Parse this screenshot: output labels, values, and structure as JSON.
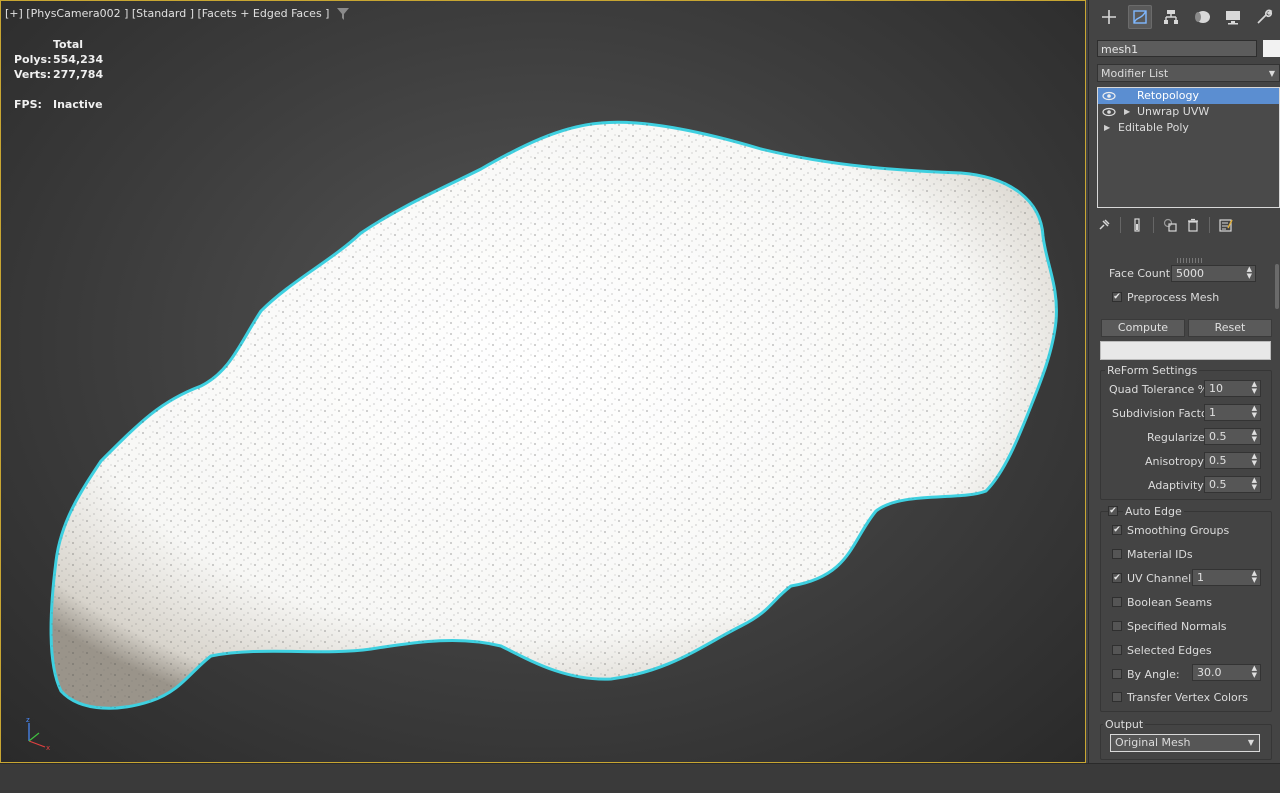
{
  "viewport": {
    "label": "[+] [PhysCamera002 ] [Standard ] [Facets + Edged Faces ]",
    "stats": {
      "header": "Total",
      "polys_label": "Polys:",
      "polys": "554,234",
      "verts_label": "Verts:",
      "verts": "277,784",
      "fps_label": "FPS:",
      "fps": "Inactive"
    },
    "selection_outline_color": "#3ed0e0",
    "border_color": "#c8a632"
  },
  "command_panel": {
    "tabs": [
      "create-icon",
      "modify-icon",
      "hierarchy-icon",
      "motion-icon",
      "display-icon",
      "utilities-icon"
    ],
    "active_tab": "modify-icon",
    "object_name": "mesh1",
    "object_color": "#f2f2f2",
    "modifier_list": "Modifier List",
    "stack": [
      {
        "name": "Retopology",
        "selected": true
      },
      {
        "name": "Unwrap UVW",
        "selected": false
      },
      {
        "name": "Editable Poly",
        "selected": false
      }
    ],
    "accent_color": "#5b8ed1"
  },
  "retopology": {
    "face_count_label": "Face Count:",
    "face_count": "5000",
    "preprocess_label": "Preprocess Mesh",
    "preprocess_checked": true,
    "compute": "Compute",
    "reset": "Reset",
    "reform_title": "ReForm Settings",
    "quad_tol_label": "Quad Tolerance %:",
    "quad_tol": "10",
    "subdiv_label": "Subdivision Factor:",
    "subdiv": "1",
    "regularize_label": "Regularize:",
    "regularize": "0.5",
    "anisotropy_label": "Anisotropy:",
    "anisotropy": "0.5",
    "adaptivity_label": "Adaptivity:",
    "adaptivity": "0.5",
    "auto_edge_label": "Auto Edge",
    "auto_edge_checked": true,
    "smoothing_label": "Smoothing Groups",
    "smoothing_checked": true,
    "matids_label": "Material IDs",
    "uv_label": "UV Channel:",
    "uv_checked": true,
    "uv_value": "1",
    "boolean_label": "Boolean Seams",
    "normals_label": "Specified Normals",
    "seledges_label": "Selected Edges",
    "angle_label": "By Angle:",
    "angle_value": "30.0",
    "tvc_label": "Transfer Vertex Colors",
    "output_title": "Output",
    "output_value": "Original Mesh"
  }
}
